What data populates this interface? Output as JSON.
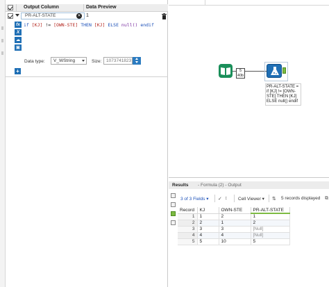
{
  "config": {
    "header": {
      "output_column": "Output Column",
      "data_preview": "Data Preview"
    },
    "field": {
      "name": "PR-ALT-STATE",
      "preview": "1"
    },
    "expression": {
      "p1": "if ",
      "f1": "[KJ]",
      "p2": " != ",
      "f2": "[OWN-STE]",
      "p3": " THEN ",
      "f3": "[KJ]",
      "p4": " ELSE ",
      "fn": "null()",
      "p5": " endif"
    },
    "data_type_label": "Data type:",
    "data_type_value": "V_WString",
    "size_label": "Size:",
    "size_value": "1073741823",
    "side_icons": [
      "fx",
      "X",
      "cloud",
      "save"
    ],
    "add_label": "+"
  },
  "canvas": {
    "count_box": {
      "line1": "5",
      "line2": "40b"
    },
    "tool_label": "PR-ALT-STATE = if [KJ] != [OWN-STE] THEN [KJ] ELSE null() endif"
  },
  "results": {
    "title": "Results",
    "subtitle": "- Formula (2) - Output",
    "fields_dropdown": "3 of 3 Fields",
    "cell_viewer": "Cell Viewer",
    "records_displayed": "5 records displayed",
    "columns": [
      "Record",
      "KJ",
      "OWN-STE",
      "PR-ALT-STATE"
    ],
    "rows": [
      {
        "record": "1",
        "kj": "1",
        "own": "2",
        "pr": "1"
      },
      {
        "record": "2",
        "kj": "2",
        "own": "1",
        "pr": "2"
      },
      {
        "record": "3",
        "kj": "3",
        "own": "3",
        "pr": "[Null]"
      },
      {
        "record": "4",
        "kj": "4",
        "own": "4",
        "pr": "[Null]"
      },
      {
        "record": "5",
        "kj": "5",
        "own": "10",
        "pr": "5"
      }
    ]
  },
  "colors": {
    "accent": "#1f6fb5",
    "tool_green": "#1a8f5a",
    "anchor_green": "#7dbb42"
  }
}
